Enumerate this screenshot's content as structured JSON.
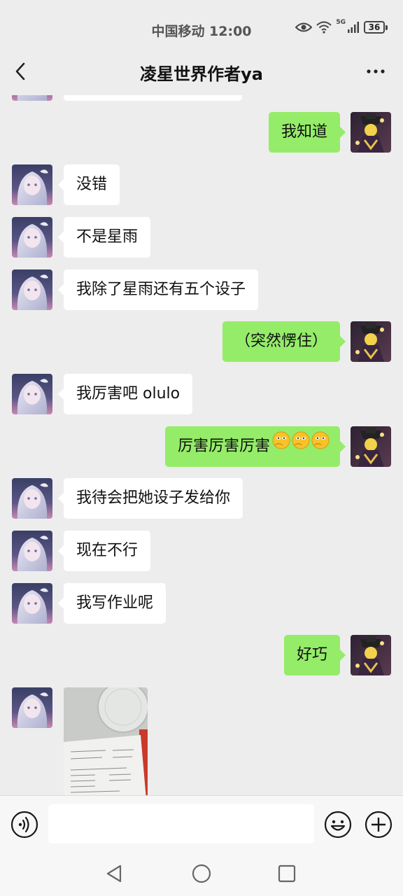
{
  "status_bar": {
    "carrier_time": "中国移动 12:00",
    "network": "5G",
    "battery": "36"
  },
  "header": {
    "title": "凌星世界作者ya"
  },
  "messages": [
    {
      "side": "right",
      "text": "我知道"
    },
    {
      "side": "left",
      "text": "没错"
    },
    {
      "side": "left",
      "text": "不是星雨"
    },
    {
      "side": "left",
      "text": "我除了星雨还有五个设子"
    },
    {
      "side": "right",
      "text": "（突然愣住）"
    },
    {
      "side": "left",
      "text": "我厉害吧 olulo"
    },
    {
      "side": "right",
      "text": "厉害厉害厉害"
    },
    {
      "side": "left",
      "text": "我待会把她设子发给你"
    },
    {
      "side": "left",
      "text": "现在不行"
    },
    {
      "side": "left",
      "text": "我写作业呢"
    },
    {
      "side": "right",
      "text": "好巧"
    }
  ],
  "colors": {
    "background": "#ededed",
    "sent_bubble": "#95ec69",
    "received_bubble": "#ffffff"
  },
  "icons": {
    "back": "chevron-left-icon",
    "more": "more-dots-icon",
    "voice": "voice-icon",
    "emoji": "emoji-icon",
    "plus": "plus-icon"
  }
}
